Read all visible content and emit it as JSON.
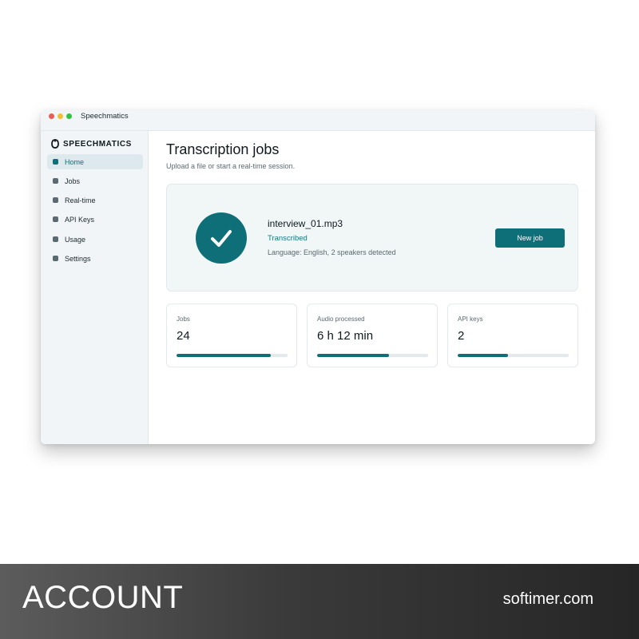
{
  "window": {
    "title": "Speechmatics"
  },
  "sidebar": {
    "brand": "SPEECHMATICS",
    "items": [
      {
        "label": "Home",
        "active": true
      },
      {
        "label": "Jobs"
      },
      {
        "label": "Real-time"
      },
      {
        "label": "API Keys"
      },
      {
        "label": "Usage"
      },
      {
        "label": "Settings"
      }
    ]
  },
  "main": {
    "title": "Transcription jobs",
    "subtitle": "Upload a file or start a real-time session.",
    "job": {
      "file_name": "interview_01.mp3",
      "status": "Transcribed",
      "meta": "Language: English, 2 speakers detected",
      "status_icon": "check-icon"
    },
    "new_job_label": "New job",
    "stats": [
      {
        "label": "Jobs",
        "value": "24",
        "progress": 0.85
      },
      {
        "label": "Audio processed",
        "value": "6 h 12 min",
        "progress": 0.65
      },
      {
        "label": "API keys",
        "value": "2",
        "progress": 0.45
      }
    ]
  },
  "footer": {
    "left": "ACCOUNT",
    "right": "softimer.com"
  },
  "colors": {
    "accent": "#0f6f78",
    "sidebar_bg": "#f1f5f7",
    "job_card_bg": "#f1f6f7"
  }
}
